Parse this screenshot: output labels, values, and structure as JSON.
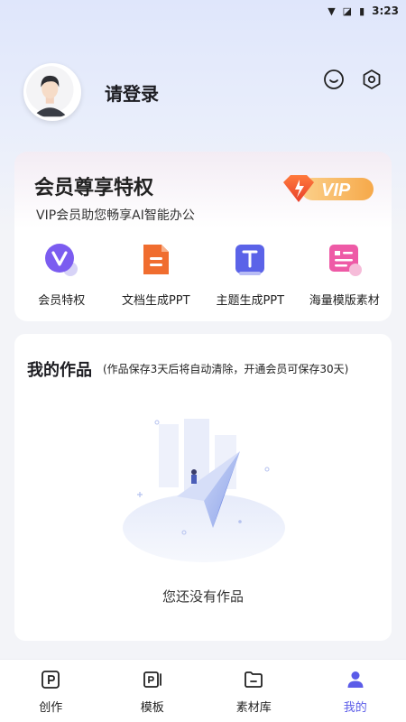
{
  "status_bar": {
    "time": "3:23"
  },
  "profile": {
    "login_label": "请登录"
  },
  "icons": {
    "feedback": "smile-icon",
    "settings": "settings-icon"
  },
  "vip": {
    "title": "会员尊享特权",
    "subtitle": "VIP会员助您畅享AI智能办公",
    "badge": "VIP",
    "features": [
      {
        "label": "会员特权",
        "icon": "vip-v-icon",
        "color": "#7b5cf0"
      },
      {
        "label": "文档生成PPT",
        "icon": "doc-icon",
        "color": "#f06d2f"
      },
      {
        "label": "主题生成PPT",
        "icon": "theme-t-icon",
        "color": "#5b63e8"
      },
      {
        "label": "海量模版素材",
        "icon": "template-icon",
        "color": "#ee5aa6"
      }
    ]
  },
  "works": {
    "title": "我的作品",
    "note": "(作品保存3天后将自动清除，开通会员可保存30天)",
    "empty_text": "您还没有作品"
  },
  "tabbar": {
    "tabs": [
      {
        "label": "创作",
        "icon": "create-p-icon"
      },
      {
        "label": "模板",
        "icon": "template-tab-icon"
      },
      {
        "label": "素材库",
        "icon": "folder-icon"
      },
      {
        "label": "我的",
        "icon": "person-icon",
        "active": true
      }
    ]
  },
  "colors": {
    "accent": "#5b5ce8",
    "vip_orange": "#f48a2a"
  }
}
